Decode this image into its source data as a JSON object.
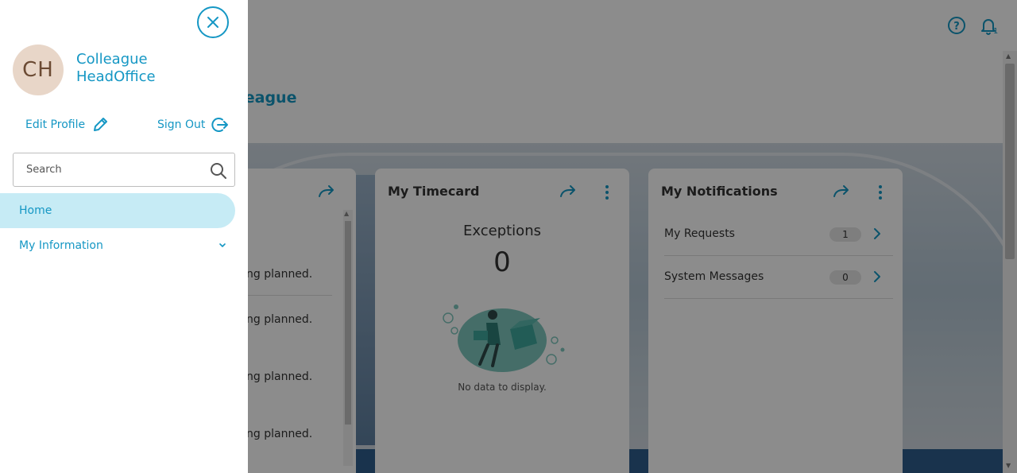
{
  "drawer": {
    "user": {
      "initials": "CH",
      "name_line1": "Colleague",
      "name_line2": "HeadOffice"
    },
    "edit_profile_label": "Edit Profile",
    "sign_out_label": "Sign Out",
    "search": {
      "placeholder": "Search",
      "value": ""
    },
    "nav": [
      {
        "label": "Home",
        "active": true
      },
      {
        "label": "My Information",
        "expandable": true
      }
    ]
  },
  "header": {
    "welcome": "ck, Colleague",
    "notification_badge": "1"
  },
  "cards": {
    "left": {
      "lines": [
        "ng planned.",
        "ng planned.",
        "ng planned.",
        "ng planned."
      ]
    },
    "timecard": {
      "title": "My Timecard",
      "exceptions_label": "Exceptions",
      "exceptions_value": "0",
      "empty_text": "No data to display."
    },
    "notifications": {
      "title": "My Notifications",
      "rows": [
        {
          "label": "My Requests",
          "count": "1"
        },
        {
          "label": "System Messages",
          "count": "0"
        }
      ]
    }
  },
  "colors": {
    "accent": "#1597c4",
    "active_nav_bg": "#c6ebf5",
    "avatar_bg": "#e8d6c8",
    "teal_illustration": "#3fa89d"
  },
  "icons": [
    "close-icon",
    "edit-pencil-icon",
    "sign-out-icon",
    "search-icon",
    "chevron-down-icon",
    "help-icon",
    "bell-icon",
    "arrow-forward-icon",
    "more-vert-icon",
    "chevron-right-icon"
  ]
}
